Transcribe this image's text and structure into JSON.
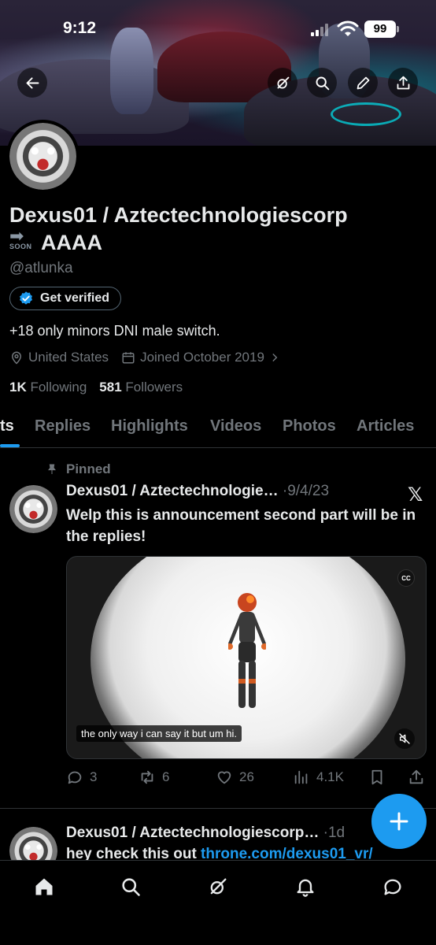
{
  "status_bar": {
    "time": "9:12",
    "battery": "99"
  },
  "profile": {
    "display_name": "Dexus01 / Aztectechnologiescorp",
    "soon_badge": "SOON",
    "display_name_line2": "AAAA",
    "handle": "@atlunka",
    "verify_label": "Get verified",
    "bio": "+18 only minors DNI male switch.",
    "location": "United States",
    "joined": "Joined October 2019",
    "following_count": "1K",
    "following_label": "Following",
    "followers_count": "581",
    "followers_label": "Followers"
  },
  "tabs": [
    {
      "label": "ts"
    },
    {
      "label": "Replies"
    },
    {
      "label": "Highlights"
    },
    {
      "label": "Videos"
    },
    {
      "label": "Photos"
    },
    {
      "label": "Articles"
    }
  ],
  "pinned_tweet": {
    "pinned_label": "Pinned",
    "name": "Dexus01 / Aztectechnologie…",
    "date": "·9/4/23",
    "text": "Welp this is announcement second part will be in the replies!",
    "cc_label": "CC",
    "caption": "the only way i can say it but um hi.",
    "replies": "3",
    "reposts": "6",
    "likes": "26",
    "views": "4.1K"
  },
  "second_tweet": {
    "name": "Dexus01 / Aztectechnologiescorp…",
    "date": "·1d",
    "text_prefix": "hey check this out ",
    "link": "throne.com/dexus01_vr/"
  },
  "colors": {
    "accent": "#1d9bf0",
    "muted": "#71767b",
    "text": "#e7e9ea",
    "background": "#000000"
  }
}
